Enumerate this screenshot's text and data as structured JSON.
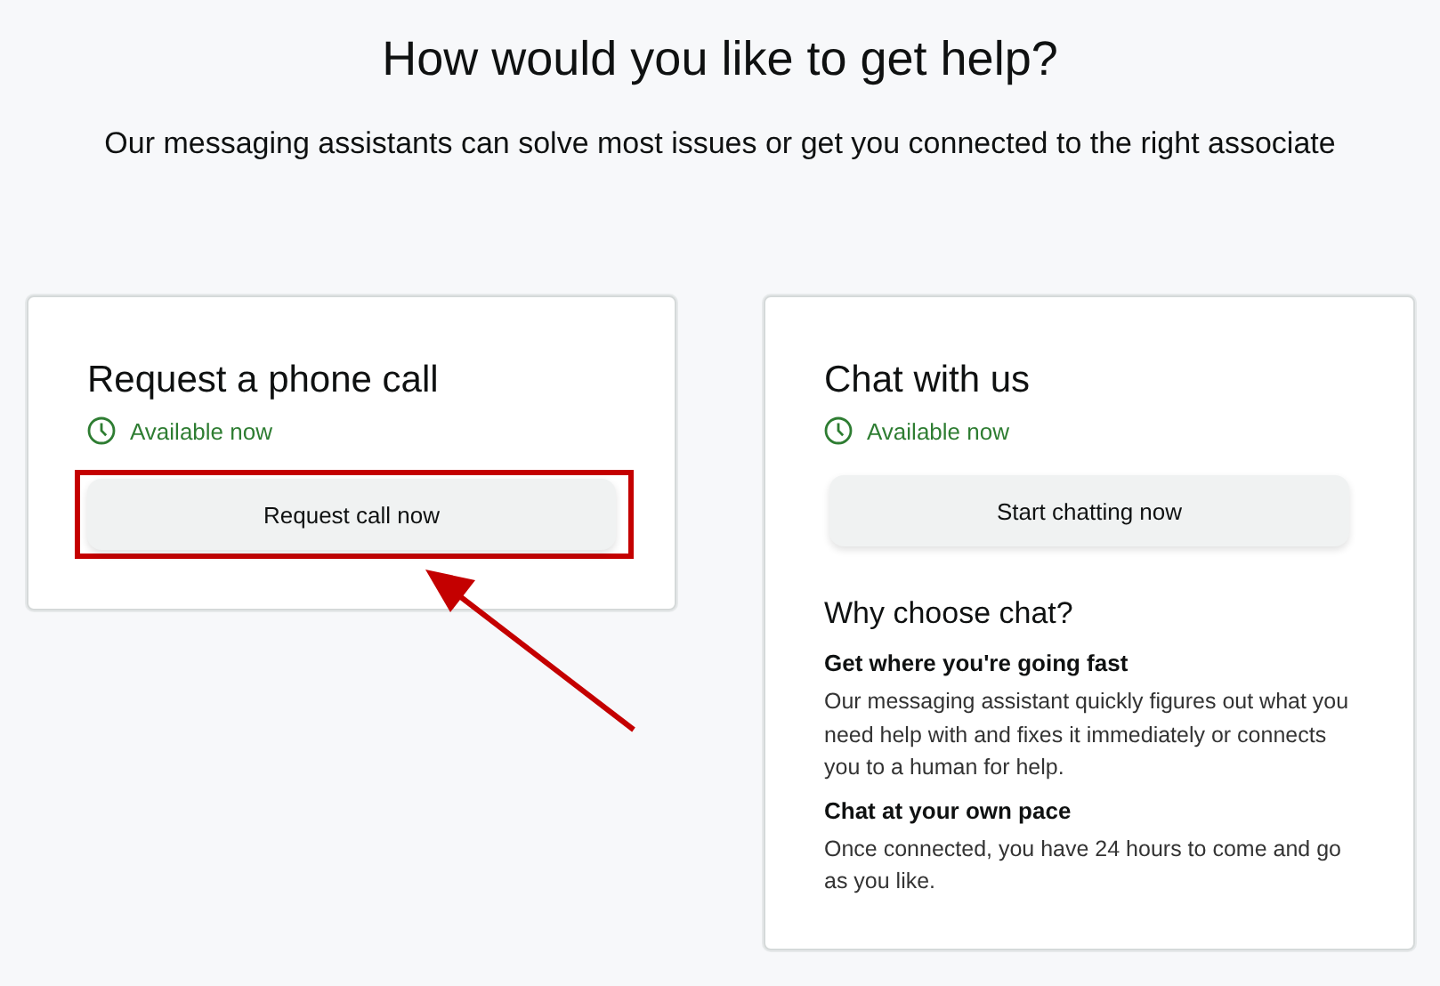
{
  "heading": "How would you like to get help?",
  "subheading": "Our messaging assistants can solve most issues or get you connected to the right associate",
  "cards": [
    {
      "title": "Request a phone call",
      "status": "Available now",
      "button": "Request call now",
      "highlighted": true
    },
    {
      "title": "Chat with us",
      "status": "Available now",
      "button": "Start chatting now",
      "highlighted": false,
      "why": {
        "title": "Why choose chat?",
        "reasons": [
          {
            "title": "Get where you're going fast",
            "text": "Our messaging assistant quickly figures out what you need help with and fixes it immediately or connects you to a human for help."
          },
          {
            "title": "Chat at your own pace",
            "text": "Once connected, you have 24 hours to come and go as you like."
          }
        ]
      }
    }
  ]
}
